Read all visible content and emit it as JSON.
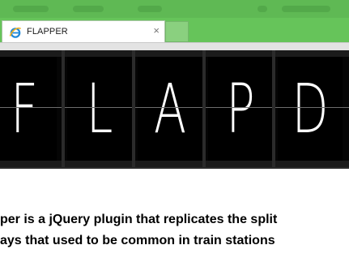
{
  "browser": {
    "tab_title": "FLAPPER",
    "close_glyph": "×",
    "tab_icon": "ie-logo-icon"
  },
  "board": {
    "letters": [
      "F",
      "L",
      "A",
      "P",
      "D"
    ],
    "colors": {
      "tile": "#000000",
      "letter": "#ffffff",
      "frame": "#1b1b1b"
    }
  },
  "article": {
    "line1": "per is a jQuery plugin that replicates the split",
    "line2": "ays that used to be common in train stations"
  },
  "colors": {
    "chrome": "#66c45a",
    "page": "#ffffff"
  }
}
